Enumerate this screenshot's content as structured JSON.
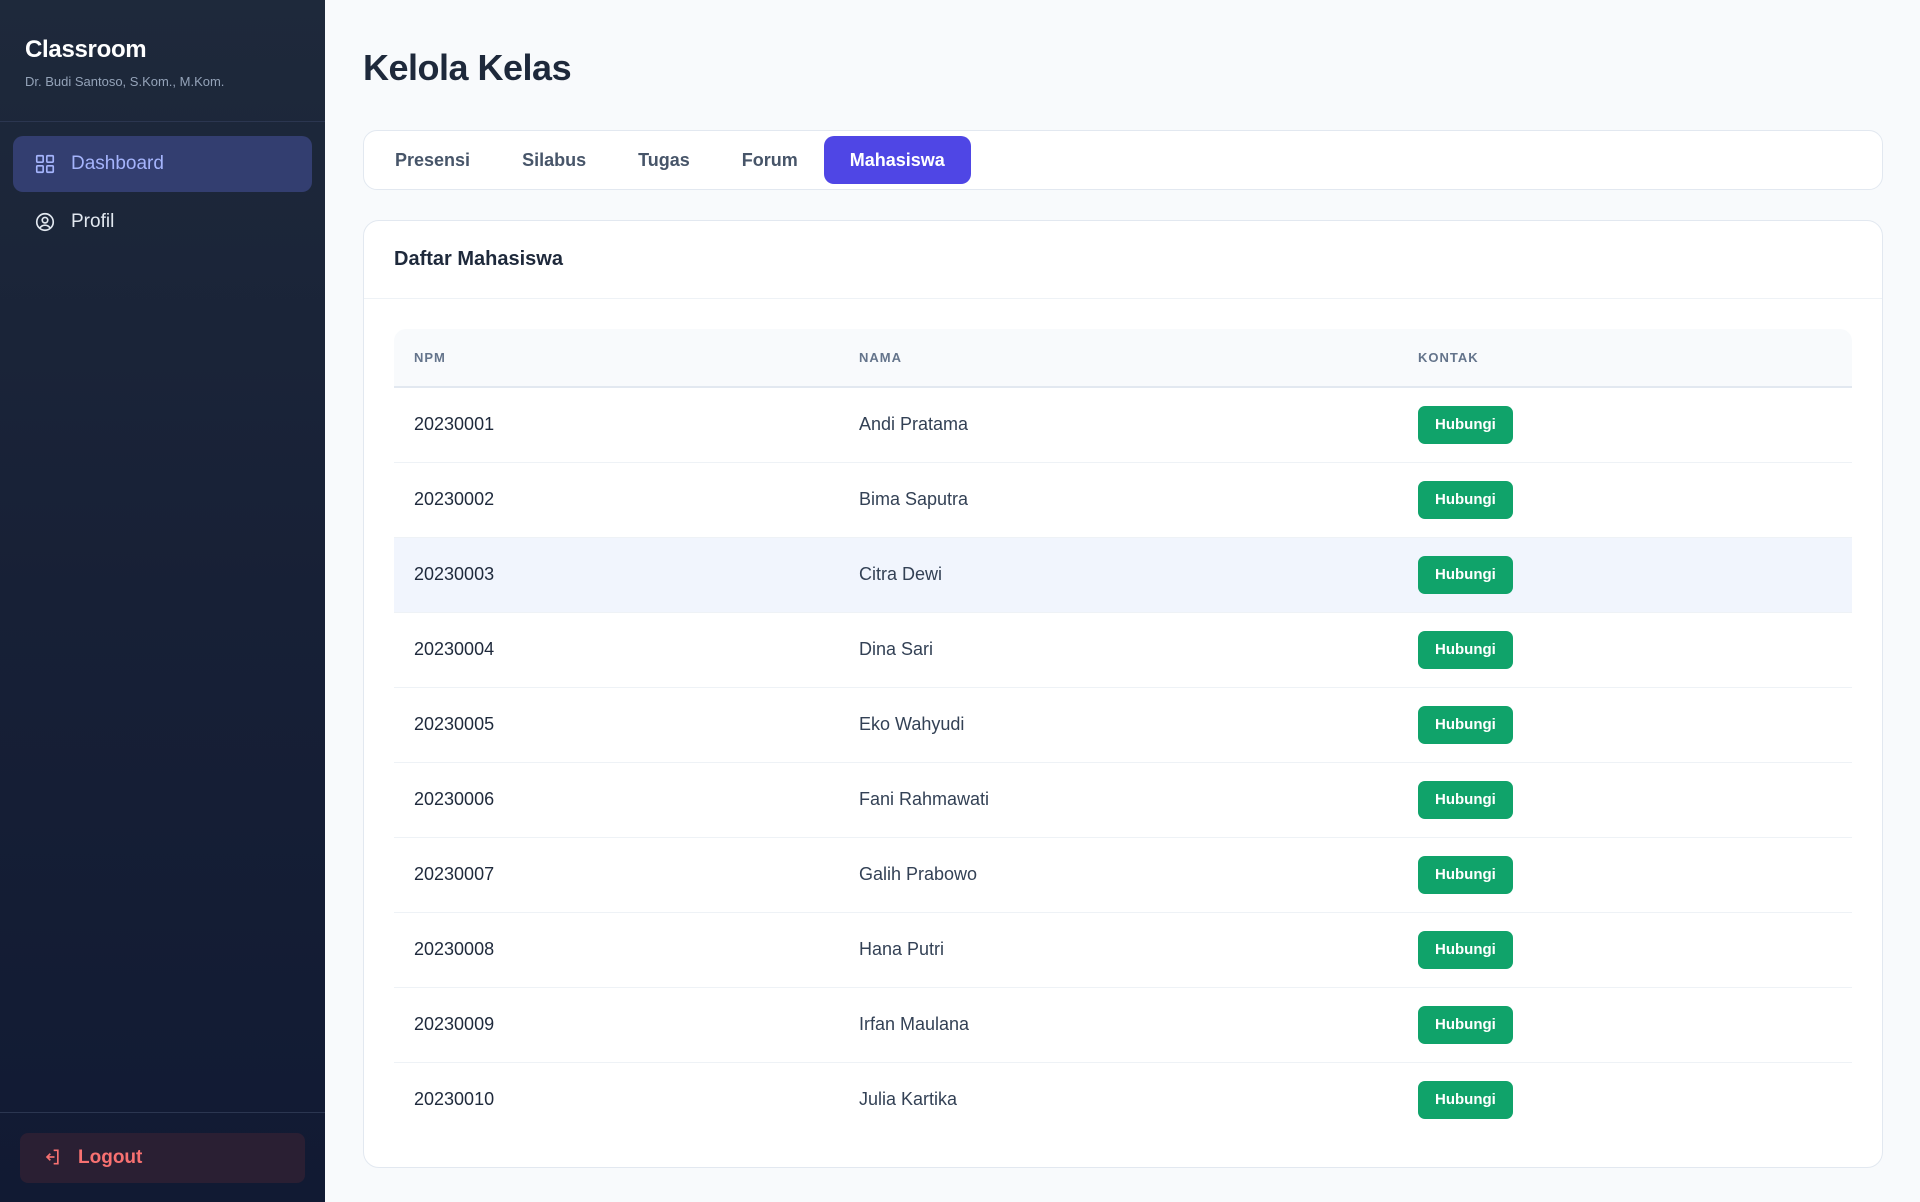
{
  "brand": {
    "title": "Classroom",
    "subtitle": "Dr. Budi Santoso, S.Kom., M.Kom."
  },
  "nav": {
    "items": [
      {
        "label": "Dashboard",
        "icon": "grid-icon",
        "active": true
      },
      {
        "label": "Profil",
        "icon": "user-circle-icon",
        "active": false
      }
    ],
    "logout_label": "Logout"
  },
  "page": {
    "title": "Kelola Kelas"
  },
  "tabs": [
    {
      "label": "Presensi"
    },
    {
      "label": "Silabus"
    },
    {
      "label": "Tugas"
    },
    {
      "label": "Forum"
    },
    {
      "label": "Mahasiswa",
      "active": true
    }
  ],
  "card": {
    "title": "Daftar Mahasiswa",
    "columns": [
      "NPM",
      "NAMA",
      "KONTAK"
    ],
    "action_label": "Hubungi",
    "rows": [
      {
        "npm": "20230001",
        "nama": "Andi Pratama"
      },
      {
        "npm": "20230002",
        "nama": "Bima Saputra"
      },
      {
        "npm": "20230003",
        "nama": "Citra Dewi"
      },
      {
        "npm": "20230004",
        "nama": "Dina Sari"
      },
      {
        "npm": "20230005",
        "nama": "Eko Wahyudi"
      },
      {
        "npm": "20230006",
        "nama": "Fani Rahmawati"
      },
      {
        "npm": "20230007",
        "nama": "Galih Prabowo"
      },
      {
        "npm": "20230008",
        "nama": "Hana Putri"
      },
      {
        "npm": "20230009",
        "nama": "Irfan Maulana"
      },
      {
        "npm": "20230010",
        "nama": "Julia Kartika"
      }
    ]
  },
  "colors": {
    "accent": "#4f46e5",
    "success": "#10a36a",
    "sidebar": "#1e293b",
    "danger": "#f87171"
  }
}
